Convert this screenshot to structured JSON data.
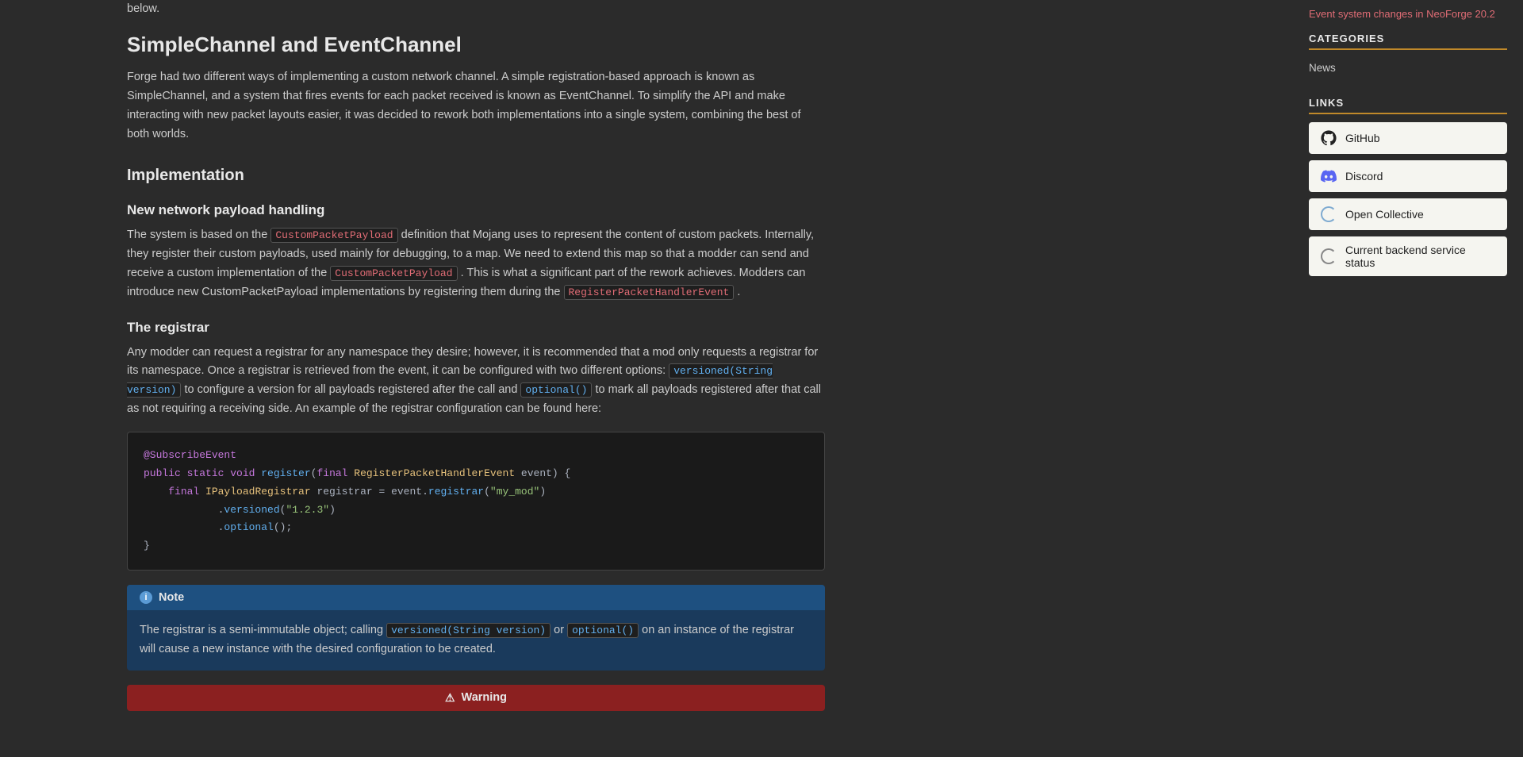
{
  "page": {
    "intro_text": "below.",
    "section1": {
      "title": "SimpleChannel and EventChannel",
      "body": "Forge had two different ways of implementing a custom network channel. A simple registration-based approach is known as SimpleChannel, and a system that fires events for each packet received is known as EventChannel. To simplify the API and make interacting with new packet layouts easier, it was decided to rework both implementations into a single system, combining the best of both worlds."
    },
    "section2": {
      "title": "Implementation",
      "subsection1": {
        "title": "New network payload handling",
        "body1_pre": "The system is based on the",
        "body1_code1": "CustomPacketPayload",
        "body1_post1": "definition that Mojang uses to represent the content of custom packets. Internally, they register their custom payloads, used mainly for debugging, to a map. We need to extend this map so that a modder can send and receive a custom implementation of the",
        "body1_code2": "CustomPacketPayload",
        "body1_post2": ". This is what a significant part of the rework achieves. Modders can introduce new CustomPacketPayload implementations by registering them during the",
        "body1_code3": "RegisterPacketHandlerEvent",
        "body1_post3": "."
      },
      "subsection2": {
        "title": "The registrar",
        "body1": "Any modder can request a registrar for any namespace they desire; however, it is recommended that a mod only requests a registrar for its namespace. Once a registrar is retrieved from the event, it can be configured with two different options:",
        "body1_code1": "versioned(String version)",
        "body1_mid": "to configure a version for all payloads registered after the call and",
        "body1_code2": "optional()",
        "body1_post": "to mark all payloads registered after that call as not requiring a receiving side. An example of the registrar configuration can be found here:"
      }
    },
    "code_block": {
      "lines": [
        "@SubscribeEvent",
        "public static void register(final RegisterPacketHandlerEvent event) {",
        "    final IPayloadRegistrar registrar = event.registrar(\"my_mod\")",
        "            .versioned(\"1.2.3\")",
        "            .optional();",
        "}"
      ]
    },
    "note_box": {
      "header": "Note",
      "body_pre": "The registrar is a semi-immutable object; calling",
      "body_code1": "versioned(String version)",
      "body_mid": "or",
      "body_code2": "optional()",
      "body_post": "on an instance of the registrar will cause a new instance with the desired configuration to be created."
    },
    "warning_box": {
      "header": "Warning"
    }
  },
  "sidebar": {
    "top_link": "Event system changes in NeoForge 20.2",
    "categories_title": "CATEGORIES",
    "nav_items": [
      {
        "label": "News"
      }
    ],
    "links_title": "LINKS",
    "link_items": [
      {
        "label": "GitHub",
        "icon": "github"
      },
      {
        "label": "Discord",
        "icon": "discord"
      },
      {
        "label": "Open Collective",
        "icon": "opencollective"
      },
      {
        "label": "Current backend service status",
        "icon": "status"
      }
    ]
  }
}
